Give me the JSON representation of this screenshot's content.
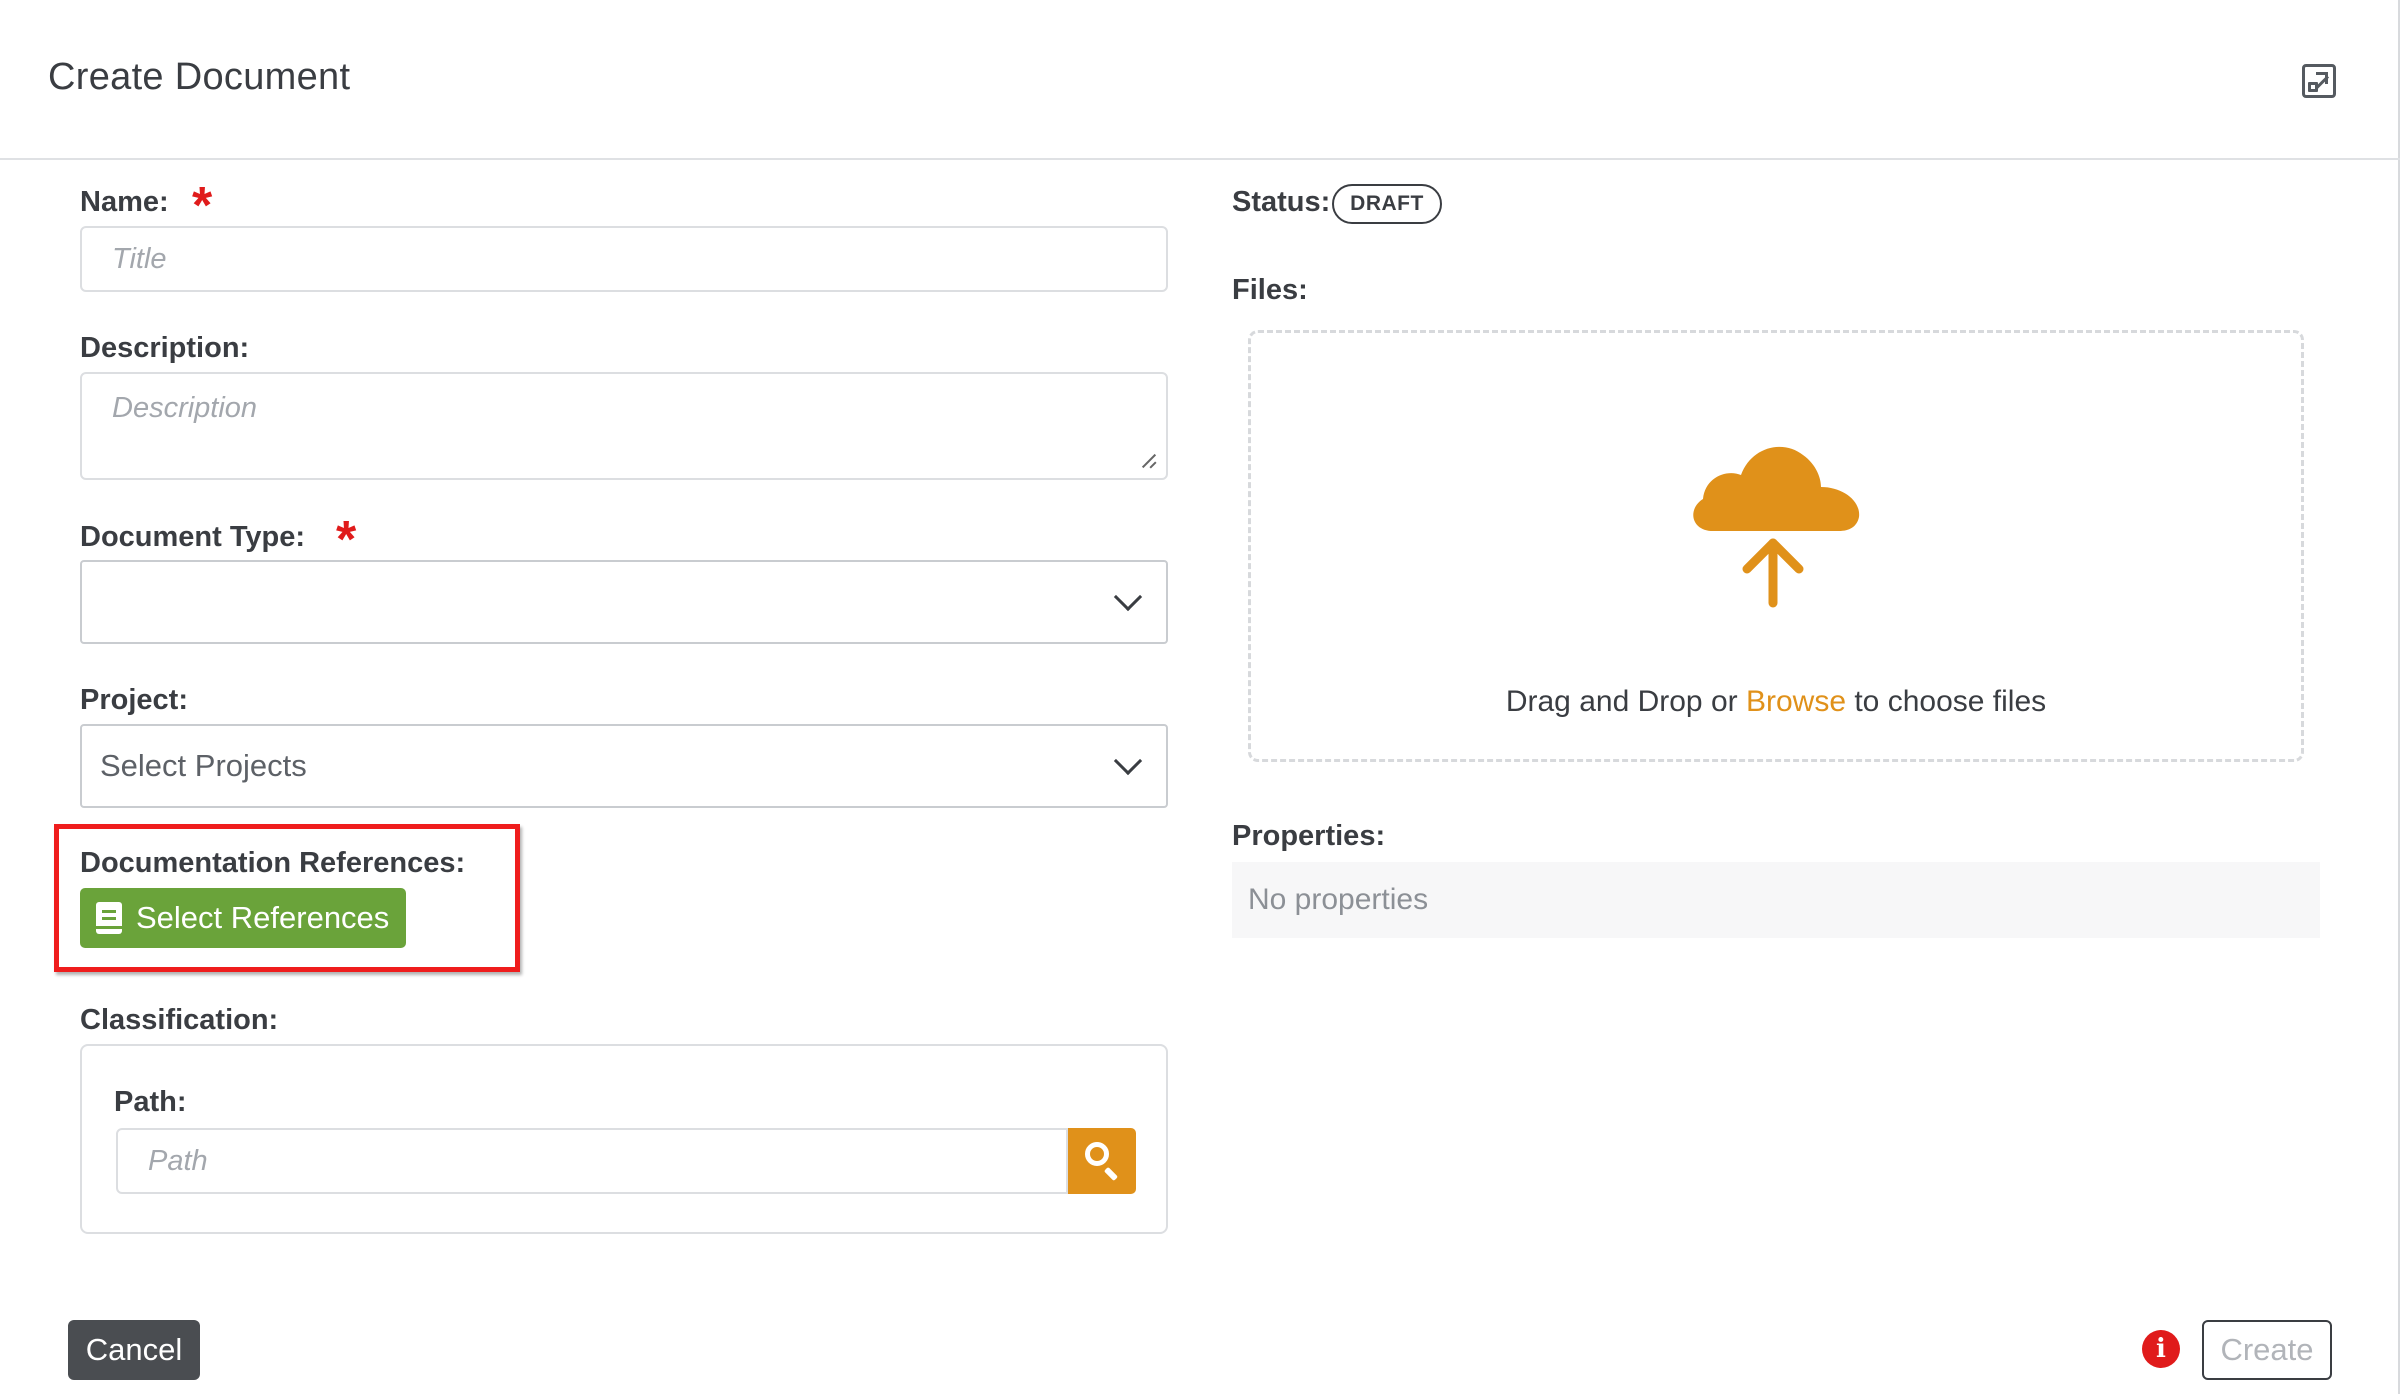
{
  "header": {
    "title": "Create Document",
    "expand_icon": "expand-icon"
  },
  "form": {
    "name": {
      "label": "Name:",
      "placeholder": "Title",
      "required_mark": "*"
    },
    "description": {
      "label": "Description:",
      "placeholder": "Description"
    },
    "document_type": {
      "label": "Document Type:",
      "value": "",
      "required_mark": "*"
    },
    "project": {
      "label": "Project:",
      "value": "Select Projects"
    },
    "references": {
      "label": "Documentation References:",
      "button_label": "Select References"
    },
    "classification": {
      "label": "Classification:",
      "path_label": "Path:",
      "path_placeholder": "Path"
    }
  },
  "right": {
    "status_label": "Status:",
    "status_value": "DRAFT",
    "files_label": "Files:",
    "drop_text_before": "Drag and Drop or ",
    "drop_text_link": "Browse",
    "drop_text_after": " to choose files",
    "properties_label": "Properties:",
    "properties_empty": "No properties"
  },
  "footer": {
    "cancel_label": "Cancel",
    "create_label": "Create",
    "info_glyph": "i"
  },
  "colors": {
    "accent_orange": "#e0911a",
    "success_green": "#6aa33a",
    "required_red": "#e01b1b",
    "highlight_red": "#ef1d1d"
  }
}
